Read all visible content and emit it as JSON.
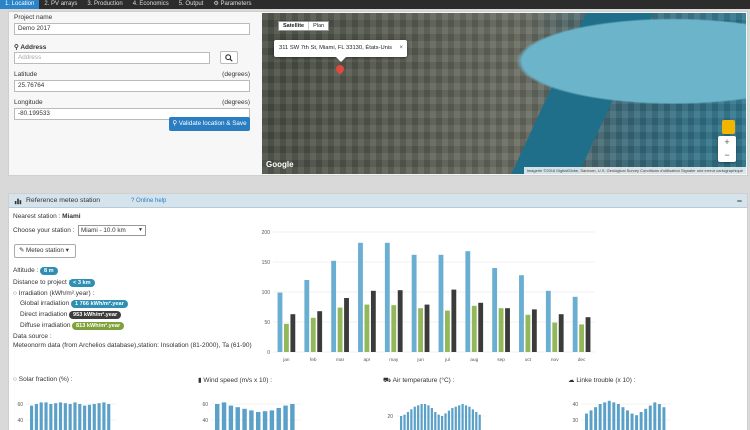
{
  "tabs": [
    {
      "label": "1. Location",
      "active": true
    },
    {
      "label": "2. PV arrays",
      "active": false
    },
    {
      "label": "3. Production",
      "active": false
    },
    {
      "label": "4. Economics",
      "active": false
    },
    {
      "label": "5. Output",
      "active": false
    },
    {
      "label": "⚙ Parameters",
      "active": false
    }
  ],
  "location": {
    "project_name_label": "Project name",
    "project_name_value": "Demo 2017",
    "address_label": "Address",
    "address_placeholder": "Address",
    "latitude_label": "Latitude",
    "latitude_unit": "(degrees)",
    "latitude_value": "25.76764",
    "longitude_label": "Longitude",
    "longitude_unit": "(degrees)",
    "longitude_value": "-80.199533",
    "validate_button": "Validate location & Save"
  },
  "map": {
    "type_satellite": "Satellite",
    "type_plan": "Plan",
    "info_text": "311 SW 7th St, Miami, FL 33130, États-Unis",
    "info_close": "×",
    "zoom_in": "+",
    "zoom_out": "−",
    "logo": "Google",
    "attribution": "Imagerie ©2016 DigitalGlobe, Sanborn, U.S. Geological Survey   Conditions d'utilisation   Signaler une erreur cartographique"
  },
  "meteo": {
    "title": "Reference meteo station",
    "help": "Online help",
    "collapse": "−",
    "nearest_label": "Nearest station : ",
    "nearest_value": "Miami",
    "choose_label": "Choose your station :",
    "choose_value": "Miami - 10.0 km",
    "meteo_button": "Meteo station",
    "altitude_label": "Altitude : ",
    "altitude_value": "8 m",
    "distance_label": "Distance to project : ",
    "distance_value": "< 3 km",
    "irradiation_label": "Irradiation (kWh/m².year) :",
    "global_label": "Global irradiation : ",
    "global_value": "1 766 kWh/m².year",
    "direct_label": "Direct irradiation : ",
    "direct_value": "953 kWh/m².year",
    "diffuse_label": "Diffuse irradiation : ",
    "diffuse_value": "813 kWh/m².year",
    "source_label": "Data source :",
    "source_value": "Meteonorm data (from Archelios database),station: Insolation (81-2000), Ta (61-90)",
    "colors": {
      "global": "#2e8fb3",
      "direct": "#3d3d3d",
      "diffuse": "#7fa13a"
    }
  },
  "chart_data": [
    {
      "type": "bar",
      "categories": [
        "jan",
        "feb",
        "mar",
        "apr",
        "may",
        "jun",
        "jul",
        "aug",
        "sep",
        "oct",
        "nov",
        "dec"
      ],
      "ylim": [
        0,
        200
      ],
      "yticks": [
        0,
        50,
        100,
        150,
        200
      ],
      "series": [
        {
          "color": "#6aaed2",
          "values": [
            99,
            120,
            152,
            182,
            182,
            162,
            162,
            168,
            140,
            128,
            102,
            92
          ]
        },
        {
          "color": "#93b85a",
          "values": [
            47,
            57,
            74,
            79,
            78,
            73,
            69,
            77,
            73,
            62,
            49,
            46
          ]
        },
        {
          "color": "#3b3b3b",
          "values": [
            63,
            68,
            90,
            102,
            103,
            79,
            104,
            82,
            73,
            71,
            63,
            58
          ]
        }
      ]
    },
    {
      "type": "bar",
      "title": "Solar fraction (%) :",
      "yticks": [
        40,
        60
      ],
      "ylim": [
        20,
        70
      ],
      "values": [
        58,
        60,
        62,
        62,
        60,
        61,
        62,
        61,
        60,
        62,
        60,
        58,
        59,
        60,
        61,
        62,
        60
      ]
    },
    {
      "type": "bar",
      "title": "Wind speed (m/s x 10) :",
      "yticks": [
        40,
        60
      ],
      "ylim": [
        20,
        70
      ],
      "values": [
        60,
        62,
        58,
        56,
        54,
        52,
        50,
        51,
        52,
        55,
        58,
        60
      ]
    },
    {
      "type": "bar",
      "title": "Air temperature (°C) :",
      "yticks": [
        20
      ],
      "ylim": [
        5,
        35
      ],
      "values": [
        20,
        21,
        23,
        25,
        27,
        28,
        29,
        29,
        28,
        26,
        23,
        21,
        20,
        22,
        24,
        26,
        27,
        28,
        29,
        28,
        27,
        25,
        23,
        21
      ]
    },
    {
      "type": "bar",
      "title": "Linke trouble (x 10) :",
      "yticks": [
        30,
        40
      ],
      "ylim": [
        20,
        45
      ],
      "values": [
        34,
        36,
        38,
        40,
        41,
        42,
        41,
        40,
        38,
        36,
        34,
        33,
        35,
        37,
        39,
        41,
        40,
        38
      ]
    }
  ]
}
